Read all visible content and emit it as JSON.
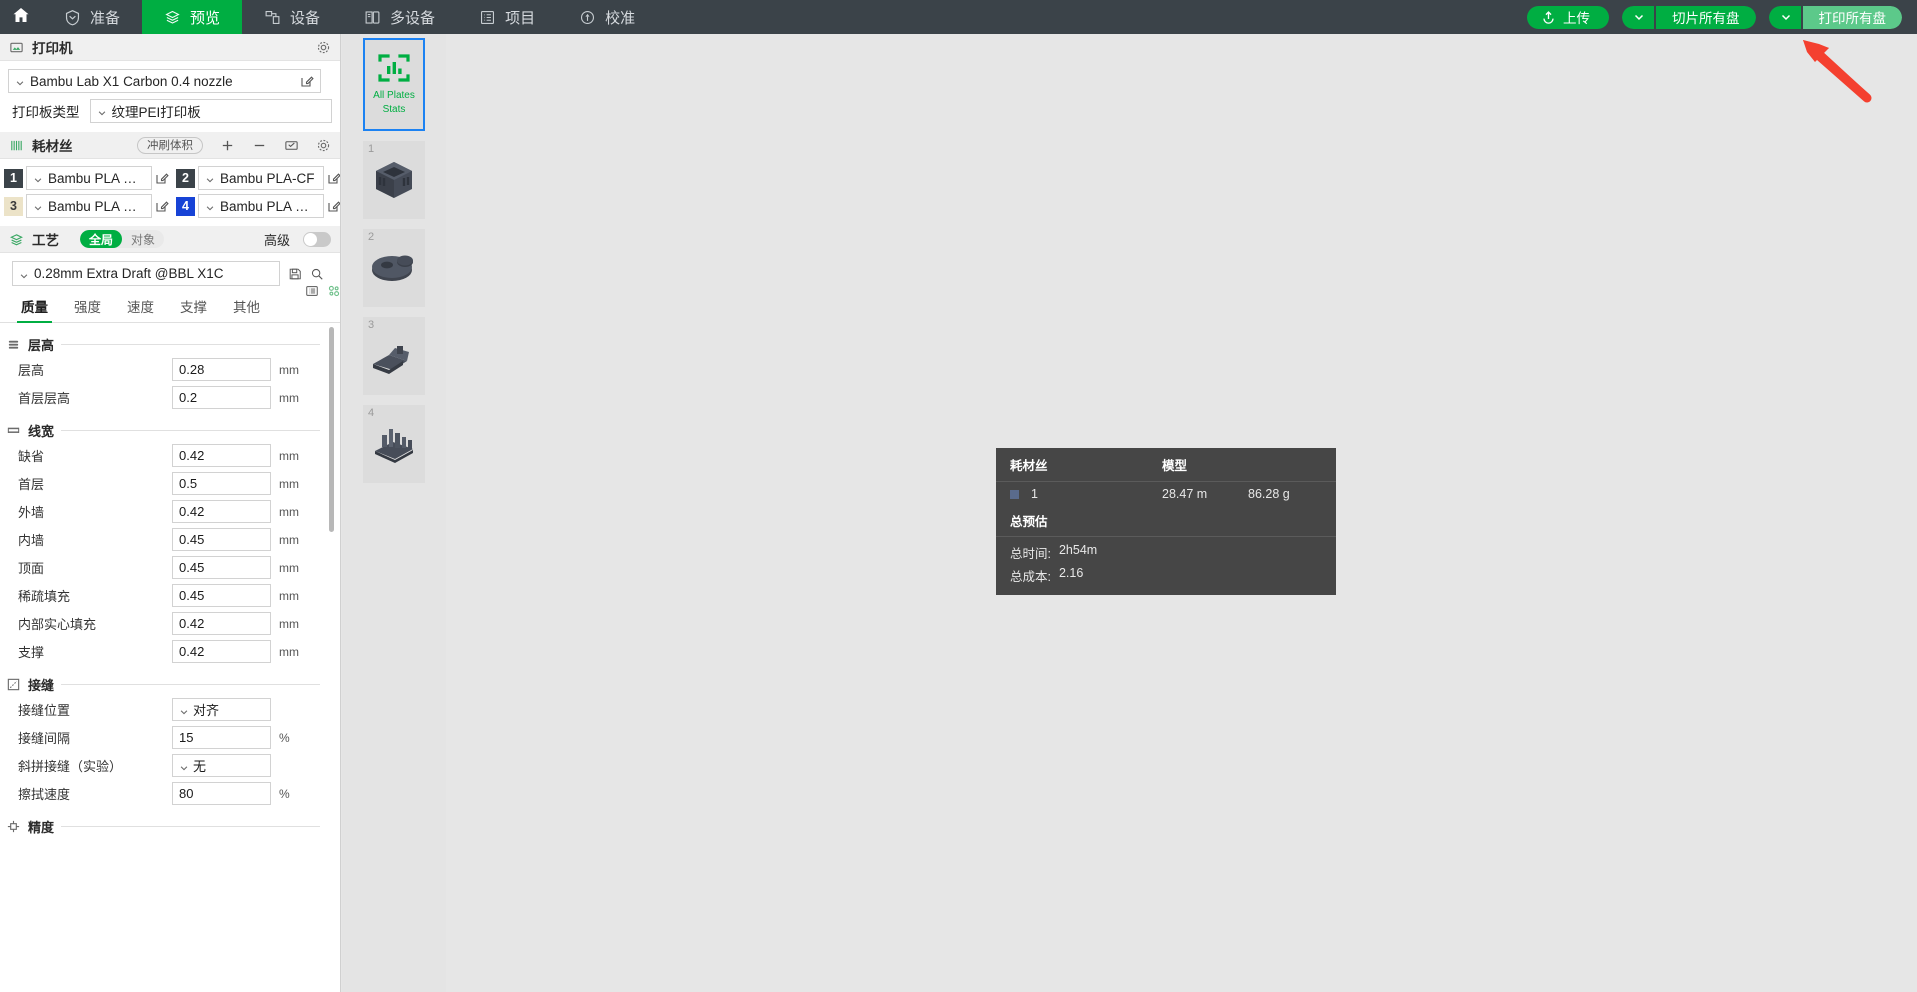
{
  "topbar": {
    "home_icon": "home-icon",
    "tabs": [
      {
        "label": "准备",
        "icon": "prepare-icon",
        "active": false
      },
      {
        "label": "预览",
        "icon": "preview-layers-icon",
        "active": true
      },
      {
        "label": "设备",
        "icon": "device-icon",
        "active": false
      },
      {
        "label": "多设备",
        "icon": "multi-device-icon",
        "active": false
      },
      {
        "label": "项目",
        "icon": "project-icon",
        "active": false
      },
      {
        "label": "校准",
        "icon": "calibration-icon",
        "active": false
      }
    ],
    "actions": {
      "upload": "上传",
      "slice_all": "切片所有盘",
      "print_all": "打印所有盘"
    },
    "accent": "#00ae42",
    "accent_light": "#5cc98a",
    "bar_bg": "#3b4349"
  },
  "printer": {
    "section_title": "打印机",
    "section_icon": "printer-icon",
    "settings_icon": "gear-icon",
    "model": "Bambu Lab X1 Carbon 0.4 nozzle",
    "edit_icon": "edit-icon",
    "plate_type_label": "打印板类型",
    "plate_type_value": "纹理PEI打印板"
  },
  "filament": {
    "section_title": "耗材丝",
    "section_icon": "filament-icon",
    "flush_volume_label": "冲刷体积",
    "add_icon": "plus-icon",
    "remove_icon": "minus-icon",
    "sync_icon": "sync-ams-icon",
    "settings_icon": "gear-icon",
    "items": [
      {
        "index": "1",
        "name": "Bambu PLA Basic",
        "badge_bg": "#3b4349",
        "badge_fg": "#ffffff"
      },
      {
        "index": "2",
        "name": "Bambu PLA-CF",
        "badge_bg": "#3b4349",
        "badge_fg": "#ffffff"
      },
      {
        "index": "3",
        "name": "Bambu PLA Matte",
        "badge_bg": "#ece3c8",
        "badge_fg": "#3b3b3b"
      },
      {
        "index": "4",
        "name": "Bambu PLA Matte",
        "badge_bg": "#1743d6",
        "badge_fg": "#ffffff"
      }
    ]
  },
  "process": {
    "section_title": "工艺",
    "section_icon": "process-layers-icon",
    "scope_global": "全局",
    "scope_object": "对象",
    "advanced_label": "高级",
    "advanced_on": false,
    "list_icon": "list-view-icon",
    "compare_icon": "compare-presets-icon",
    "preset": "0.28mm Extra Draft @BBL X1C",
    "save_icon": "save-icon",
    "search_icon": "search-icon",
    "tabs": [
      {
        "label": "质量",
        "active": true
      },
      {
        "label": "强度",
        "active": false
      },
      {
        "label": "速度",
        "active": false
      },
      {
        "label": "支撑",
        "active": false
      },
      {
        "label": "其他",
        "active": false
      }
    ],
    "groups": [
      {
        "title": "层高",
        "icon": "layer-height-icon",
        "rows": [
          {
            "label": "层高",
            "value": "0.28",
            "unit": "mm",
            "type": "input"
          },
          {
            "label": "首层层高",
            "value": "0.2",
            "unit": "mm",
            "type": "input"
          }
        ]
      },
      {
        "title": "线宽",
        "icon": "line-width-icon",
        "rows": [
          {
            "label": "缺省",
            "value": "0.42",
            "unit": "mm",
            "type": "input"
          },
          {
            "label": "首层",
            "value": "0.5",
            "unit": "mm",
            "type": "input"
          },
          {
            "label": "外墙",
            "value": "0.42",
            "unit": "mm",
            "type": "input"
          },
          {
            "label": "内墙",
            "value": "0.45",
            "unit": "mm",
            "type": "input"
          },
          {
            "label": "顶面",
            "value": "0.45",
            "unit": "mm",
            "type": "input"
          },
          {
            "label": "稀疏填充",
            "value": "0.45",
            "unit": "mm",
            "type": "input"
          },
          {
            "label": "内部实心填充",
            "value": "0.42",
            "unit": "mm",
            "type": "input"
          },
          {
            "label": "支撑",
            "value": "0.42",
            "unit": "mm",
            "type": "input"
          }
        ]
      },
      {
        "title": "接缝",
        "icon": "seam-icon",
        "rows": [
          {
            "label": "接缝位置",
            "value": "对齐",
            "unit": "",
            "type": "select"
          },
          {
            "label": "接缝间隔",
            "value": "15",
            "unit": "%",
            "type": "input"
          },
          {
            "label": "斜拼接缝（实验）",
            "value": "无",
            "unit": "",
            "type": "select"
          },
          {
            "label": "擦拭速度",
            "value": "80",
            "unit": "%",
            "type": "input"
          }
        ]
      },
      {
        "title": "精度",
        "icon": "precision-icon",
        "rows": []
      }
    ]
  },
  "rail": {
    "stats_card": {
      "icon": "bar-chart-icon",
      "line1": "All Plates",
      "line2": "Stats",
      "selected": true,
      "border_color": "#1c82f2",
      "text_color": "#00ae42"
    },
    "plates": [
      {
        "number": "1",
        "model": "cube-model"
      },
      {
        "number": "2",
        "model": "disc-gear-model"
      },
      {
        "number": "3",
        "model": "bracket-model"
      },
      {
        "number": "4",
        "model": "city-model"
      }
    ]
  },
  "stats_panel": {
    "headers": {
      "filament": "耗材丝",
      "model": "模型"
    },
    "rows": [
      {
        "swatch": "#5a6b8c",
        "index": "1",
        "length": "28.47 m",
        "weight": "86.28 g"
      }
    ],
    "total_title": "总预估",
    "total_time_label": "总时间:",
    "total_time_value": "2h54m",
    "total_cost_label": "总成本:",
    "total_cost_value": "2.16",
    "bg": "#464646"
  },
  "annotation": {
    "arrow_color": "#f4402f",
    "points_at": "打印所有盘"
  }
}
